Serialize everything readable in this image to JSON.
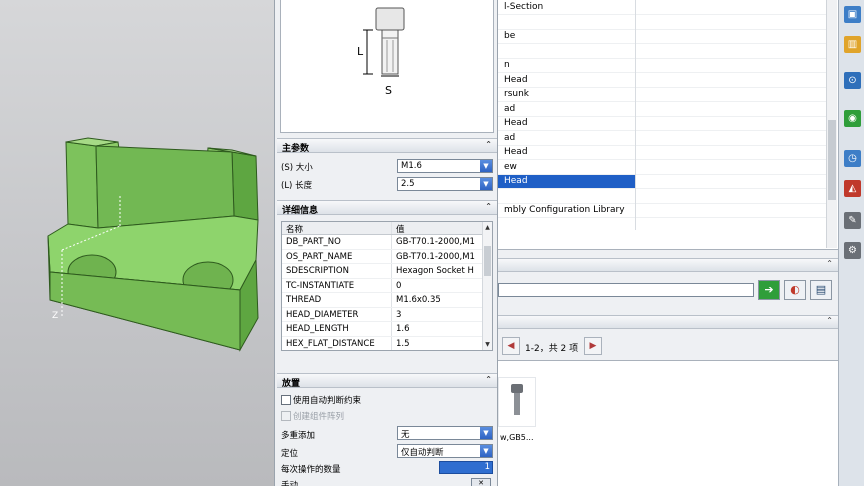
{
  "dialog": {
    "preview_labels": {
      "length": "L",
      "size": "S"
    },
    "main_params": {
      "title": "主参数",
      "size_label": "(S) 大小",
      "size_value": "M1.6",
      "length_label": "(L) 长度",
      "length_value": "2.5"
    },
    "details": {
      "title": "详细信息",
      "col_name": "名称",
      "col_value": "值",
      "rows": [
        {
          "name": "DB_PART_NO",
          "value": "GB-T70.1-2000,M1"
        },
        {
          "name": "OS_PART_NAME",
          "value": "GB-T70.1-2000,M1"
        },
        {
          "name": "SDESCRIPTION",
          "value": "Hexagon Socket H"
        },
        {
          "name": "TC-INSTANTIATE",
          "value": "0"
        },
        {
          "name": "THREAD",
          "value": "M1.6x0.35"
        },
        {
          "name": "HEAD_DIAMETER",
          "value": "3"
        },
        {
          "name": "HEAD_LENGTH",
          "value": "1.6"
        },
        {
          "name": "HEX_FLAT_DISTANCE",
          "value": "1.5"
        }
      ]
    },
    "placement": {
      "title": "放置",
      "auto_constraint": "使用自动判断约束",
      "create_array": "创建组件阵列",
      "multi_add_label": "多重添加",
      "multi_add_value": "无",
      "position_label": "定位",
      "position_value": "仅自动判断",
      "count_label": "每次操作的数量",
      "count_value": "1",
      "cut_label": "手动"
    }
  },
  "library": {
    "items": [
      "l-Section",
      "",
      "be",
      "",
      "n",
      "Head",
      "rsunk",
      "ad",
      "Head",
      "ad",
      "Head",
      "ew",
      "Head",
      "",
      "mbly Configuration Library"
    ],
    "selected_index": 12,
    "pager_text": "1-2，共 2 项",
    "result_label": "w,GB5..."
  },
  "colors": {
    "part_green": "#7dc25c",
    "selection_blue": "#1f5fc6",
    "go_green": "#2f9e3a"
  },
  "icons": [
    "resource-icon-1",
    "resource-icon-2",
    "resource-icon-3",
    "resource-icon-4",
    "resource-icon-5",
    "resource-icon-6",
    "resource-icon-7",
    "resource-icon-8",
    "resource-icon-9"
  ]
}
